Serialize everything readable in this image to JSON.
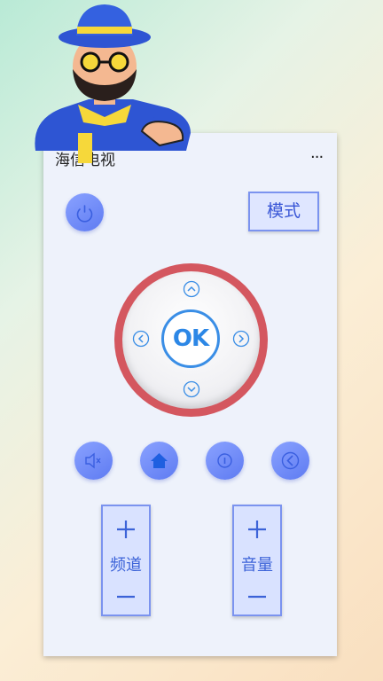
{
  "app": {
    "title": "海信电视",
    "more_label": "···"
  },
  "controls": {
    "power_icon": "power-icon",
    "mode_label": "模式",
    "ok_label": "OK",
    "channel_label": "频道",
    "volume_label": "音量"
  },
  "icons": {
    "mute": "speaker-mute-icon",
    "home": "home-icon",
    "menu": "info-circle-icon",
    "back": "back-arrow-icon",
    "up": "chevron-up-icon",
    "down": "chevron-down-icon",
    "left": "chevron-left-icon",
    "right": "chevron-right-icon"
  },
  "colors": {
    "accent": "#5e7bf2",
    "dpad_ring": "#d4575f",
    "ok_blue": "#2c87e6"
  }
}
